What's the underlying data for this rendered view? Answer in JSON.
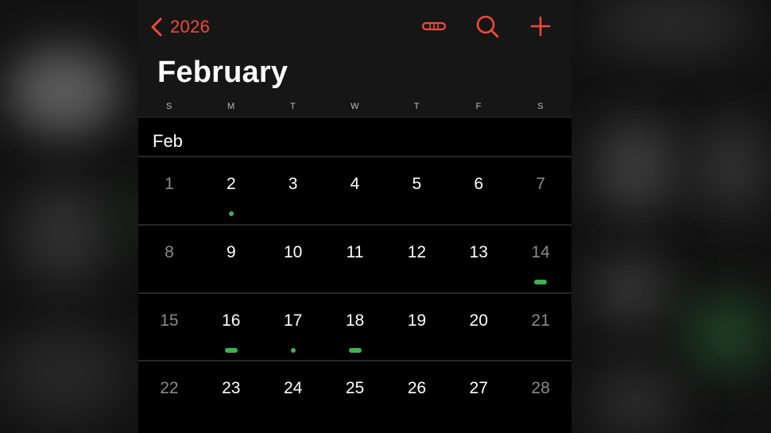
{
  "header": {
    "back_label": "2026",
    "month_title": "February",
    "icons": [
      "chevron-left-icon",
      "list-view-icon",
      "search-icon",
      "plus-icon"
    ],
    "accent_color": "#ef4a3a"
  },
  "weekdays": [
    "S",
    "M",
    "T",
    "W",
    "T",
    "F",
    "S"
  ],
  "month_label": "Feb",
  "event_dot_color": "#3fb34f",
  "weeks": [
    [
      {
        "d": "1",
        "ev": ""
      },
      {
        "d": "2",
        "ev": "small"
      },
      {
        "d": "3",
        "ev": ""
      },
      {
        "d": "4",
        "ev": ""
      },
      {
        "d": "5",
        "ev": ""
      },
      {
        "d": "6",
        "ev": ""
      },
      {
        "d": "7",
        "ev": ""
      }
    ],
    [
      {
        "d": "8",
        "ev": ""
      },
      {
        "d": "9",
        "ev": ""
      },
      {
        "d": "10",
        "ev": ""
      },
      {
        "d": "11",
        "ev": ""
      },
      {
        "d": "12",
        "ev": ""
      },
      {
        "d": "13",
        "ev": ""
      },
      {
        "d": "14",
        "ev": "wide"
      }
    ],
    [
      {
        "d": "15",
        "ev": ""
      },
      {
        "d": "16",
        "ev": "wide"
      },
      {
        "d": "17",
        "ev": "small"
      },
      {
        "d": "18",
        "ev": "wide"
      },
      {
        "d": "19",
        "ev": ""
      },
      {
        "d": "20",
        "ev": ""
      },
      {
        "d": "21",
        "ev": ""
      }
    ],
    [
      {
        "d": "22",
        "ev": ""
      },
      {
        "d": "23",
        "ev": ""
      },
      {
        "d": "24",
        "ev": ""
      },
      {
        "d": "25",
        "ev": ""
      },
      {
        "d": "26",
        "ev": ""
      },
      {
        "d": "27",
        "ev": ""
      },
      {
        "d": "28",
        "ev": ""
      }
    ]
  ]
}
